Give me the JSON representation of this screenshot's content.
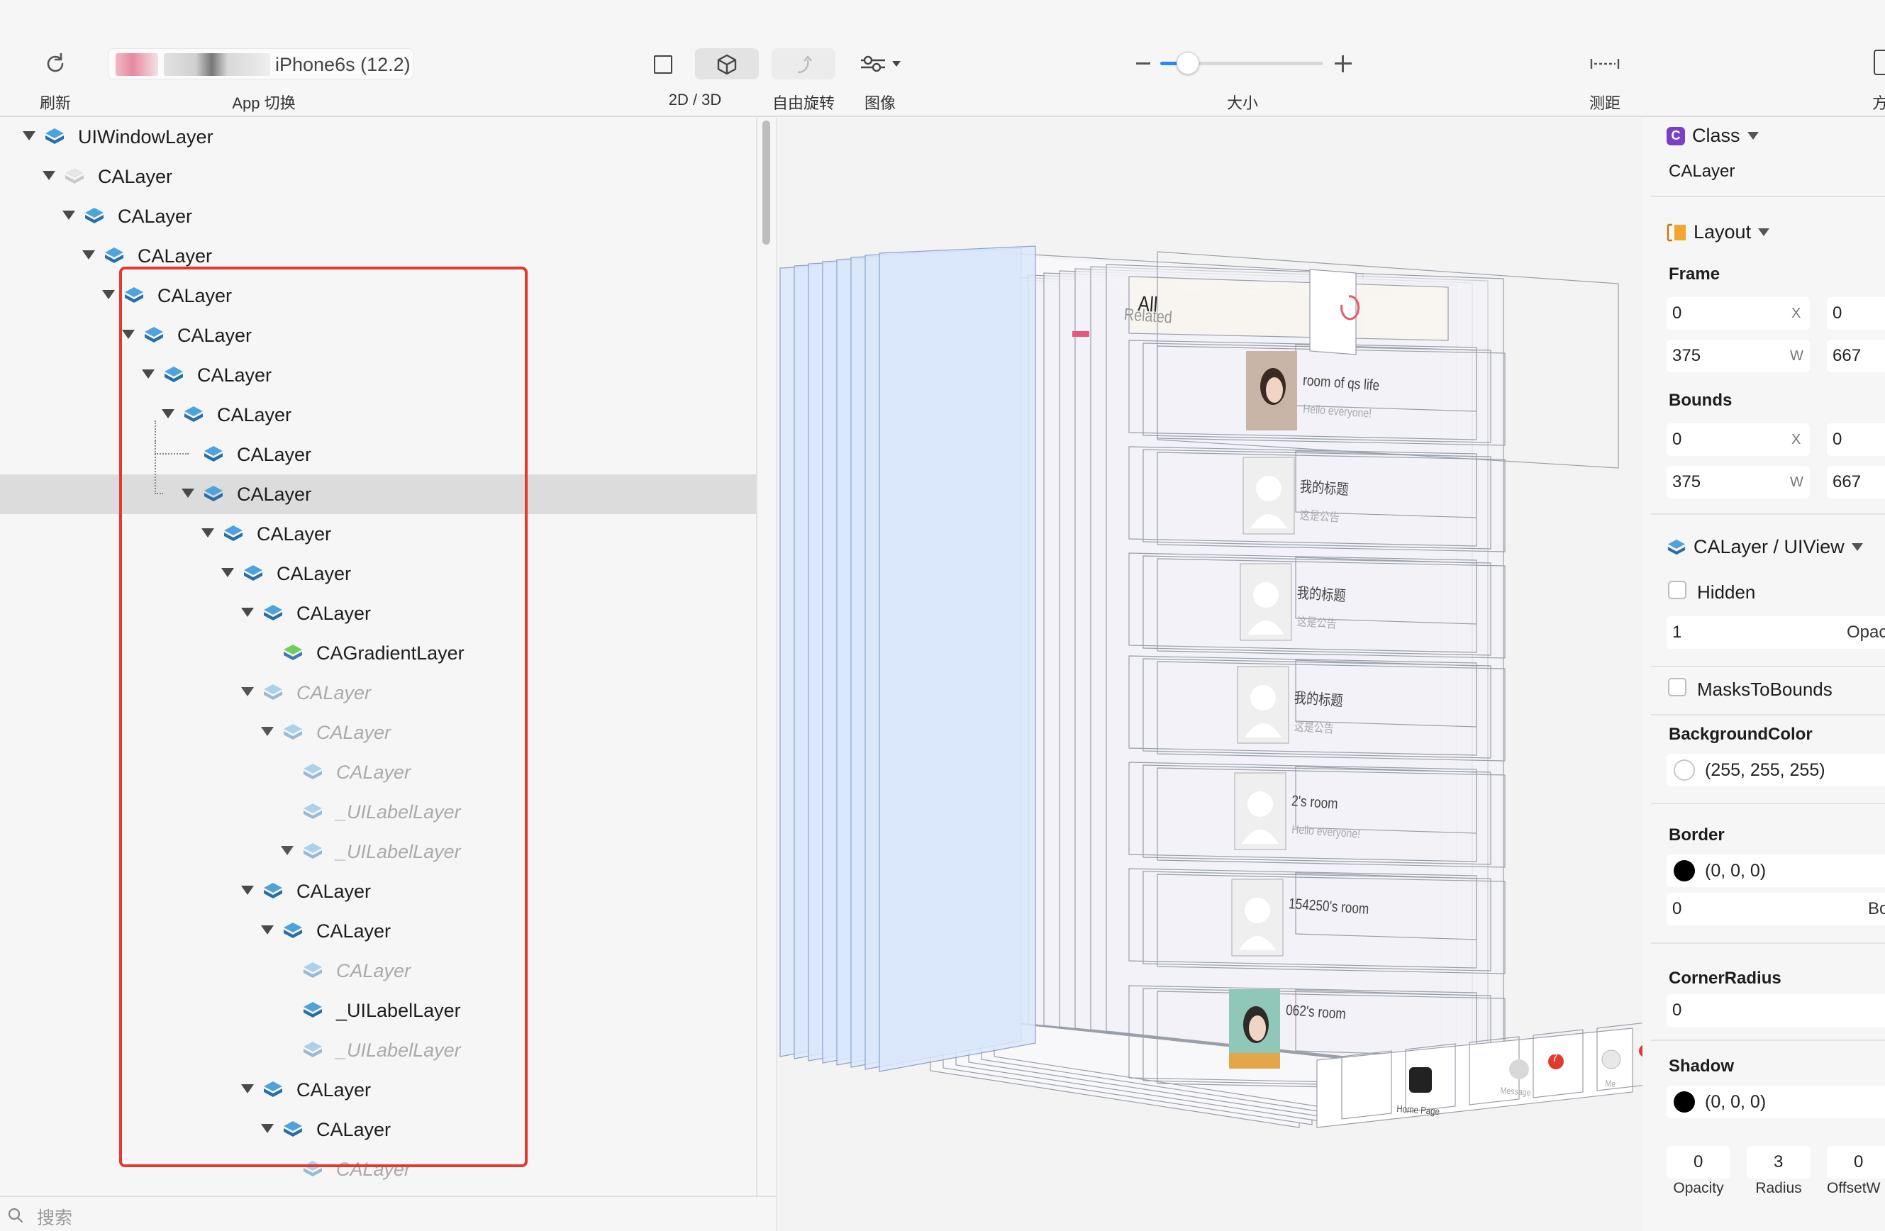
{
  "toolbar": {
    "refresh_label": "刷新",
    "app_switch_label": "App 切换",
    "device": "iPhone6s (12.2)",
    "mode_label": "2D / 3D",
    "free_rotate_label": "自由旋转",
    "image_label": "图像",
    "size_label": "大小",
    "measure_label": "测距",
    "method_label": "方法",
    "zoom_fraction": 0.17
  },
  "tree": {
    "rows": [
      {
        "label": "UIWindowLayer",
        "depth": 0,
        "expanded": true,
        "dim": false,
        "selected": false,
        "icon": "layer"
      },
      {
        "label": "CALayer",
        "depth": 1,
        "expanded": true,
        "dim": false,
        "selected": false,
        "icon": "layer-light"
      },
      {
        "label": "CALayer",
        "depth": 2,
        "expanded": true,
        "dim": false,
        "selected": false,
        "icon": "layer"
      },
      {
        "label": "CALayer",
        "depth": 3,
        "expanded": true,
        "dim": false,
        "selected": false,
        "icon": "layer"
      },
      {
        "label": "CALayer",
        "depth": 4,
        "expanded": true,
        "dim": false,
        "selected": false,
        "icon": "layer"
      },
      {
        "label": "CALayer",
        "depth": 5,
        "expanded": true,
        "dim": false,
        "selected": false,
        "icon": "layer"
      },
      {
        "label": "CALayer",
        "depth": 6,
        "expanded": true,
        "dim": false,
        "selected": false,
        "icon": "layer"
      },
      {
        "label": "CALayer",
        "depth": 7,
        "expanded": true,
        "dim": false,
        "selected": false,
        "icon": "layer"
      },
      {
        "label": "CALayer",
        "depth": 8,
        "expanded": false,
        "dim": false,
        "selected": false,
        "icon": "layer",
        "connector": true
      },
      {
        "label": "CALayer",
        "depth": 8,
        "expanded": true,
        "dim": false,
        "selected": true,
        "icon": "layer",
        "connector": true
      },
      {
        "label": "CALayer",
        "depth": 9,
        "expanded": true,
        "dim": false,
        "selected": false,
        "icon": "layer"
      },
      {
        "label": "CALayer",
        "depth": 10,
        "expanded": true,
        "dim": false,
        "selected": false,
        "icon": "layer"
      },
      {
        "label": "CALayer",
        "depth": 11,
        "expanded": true,
        "dim": false,
        "selected": false,
        "icon": "layer"
      },
      {
        "label": "CAGradientLayer",
        "depth": 12,
        "expanded": false,
        "dim": false,
        "selected": false,
        "icon": "gradient"
      },
      {
        "label": "CALayer",
        "depth": 11,
        "expanded": true,
        "dim": true,
        "selected": false,
        "icon": "layer"
      },
      {
        "label": "CALayer",
        "depth": 12,
        "expanded": true,
        "dim": true,
        "selected": false,
        "icon": "layer"
      },
      {
        "label": "CALayer",
        "depth": 13,
        "expanded": false,
        "dim": true,
        "selected": false,
        "icon": "layer"
      },
      {
        "label": "_UILabelLayer",
        "depth": 13,
        "expanded": false,
        "dim": true,
        "selected": false,
        "icon": "layer"
      },
      {
        "label": "_UILabelLayer",
        "depth": 13,
        "expanded": true,
        "dim": true,
        "selected": false,
        "icon": "layer"
      },
      {
        "label": "CALayer",
        "depth": 11,
        "expanded": true,
        "dim": false,
        "selected": false,
        "icon": "layer"
      },
      {
        "label": "CALayer",
        "depth": 12,
        "expanded": true,
        "dim": false,
        "selected": false,
        "icon": "layer"
      },
      {
        "label": "CALayer",
        "depth": 13,
        "expanded": false,
        "dim": true,
        "selected": false,
        "icon": "layer"
      },
      {
        "label": "_UILabelLayer",
        "depth": 13,
        "expanded": false,
        "dim": false,
        "selected": false,
        "icon": "layer"
      },
      {
        "label": "_UILabelLayer",
        "depth": 13,
        "expanded": false,
        "dim": true,
        "selected": false,
        "icon": "layer"
      },
      {
        "label": "CALayer",
        "depth": 11,
        "expanded": true,
        "dim": false,
        "selected": false,
        "icon": "layer"
      },
      {
        "label": "CALayer",
        "depth": 12,
        "expanded": true,
        "dim": false,
        "selected": false,
        "icon": "layer"
      },
      {
        "label": "CALayer",
        "depth": 13,
        "expanded": false,
        "dim": true,
        "selected": false,
        "icon": "layer"
      }
    ],
    "search_placeholder": "搜索"
  },
  "canvas": {
    "tab_all": "All",
    "tab_related": "Related",
    "rooms": [
      {
        "title": "room of qs life",
        "subtitle": "Hello everyone!"
      },
      {
        "title": "我的标题",
        "subtitle": "这是公告"
      },
      {
        "title": "我的标题",
        "subtitle": "这是公告"
      },
      {
        "title": "我的标题",
        "subtitle": "这是公告"
      },
      {
        "title": "2's room",
        "subtitle": "Hello everyone!"
      },
      {
        "title": "154250's room",
        "subtitle": ""
      },
      {
        "title": "062's room",
        "subtitle": ""
      }
    ],
    "tab_home": "Home Page",
    "tab_message": "Message",
    "tab_me": "Me",
    "badge": "7"
  },
  "inspector": {
    "class_header": "Class",
    "class_value": "CALayer",
    "layout_header": "Layout",
    "frame_label": "Frame",
    "frame": {
      "x": "0",
      "y": "0",
      "w": "375",
      "h": "667",
      "x_suffix": "X",
      "w_suffix": "W"
    },
    "bounds_label": "Bounds",
    "bounds": {
      "x": "0",
      "y": "0",
      "w": "375",
      "h": "667",
      "x_suffix": "X",
      "w_suffix": "W"
    },
    "calayer_header": "CALayer / UIView",
    "hidden_label": "Hidden",
    "opacity_value": "1",
    "opacity_trunc": "Opac",
    "masks_label": "MasksToBounds",
    "bgcolor_label": "BackgroundColor",
    "bgcolor_value": "(255, 255, 255)",
    "border_label": "Border",
    "border_color_value": "(0, 0, 0)",
    "border_width_value": "0",
    "border_trunc": "Bo",
    "corner_label": "CornerRadius",
    "corner_value": "0",
    "shadow_label": "Shadow",
    "shadow_color_value": "(0, 0, 0)",
    "shadow_opacity": "0",
    "shadow_radius": "3",
    "shadow_offset": "0",
    "opacity_label": "Opacity",
    "radius_label": "Radius",
    "offset_label": "OffsetW"
  }
}
